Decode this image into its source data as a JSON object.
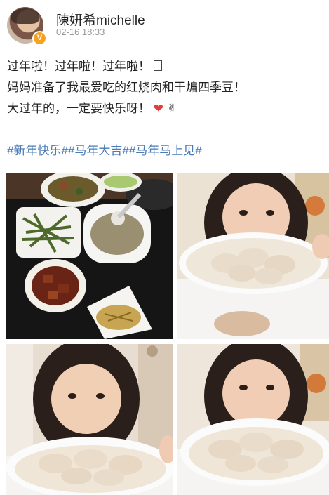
{
  "post": {
    "author": {
      "name": "陳妍希michelle",
      "verified_icon": "verified-badge-icon"
    },
    "timestamp": "02-16 18:33",
    "lines": [
      "过年啦！过年啦！过年啦！",
      "妈妈准备了我最爱吃的红烧肉和干煸四季豆！",
      "大过年的，一定要快乐呀！"
    ],
    "line1_emoji_icon": "box-emoji-icon",
    "line3_icons": [
      "heart-icon",
      "hand-icon"
    ],
    "hashtags": "#新年快乐##马年大吉##马年马上见#"
  },
  "colors": {
    "hashtag": "#4a7bb7",
    "text": "#222222",
    "meta": "#999999",
    "badge": "#f6a21e"
  }
}
